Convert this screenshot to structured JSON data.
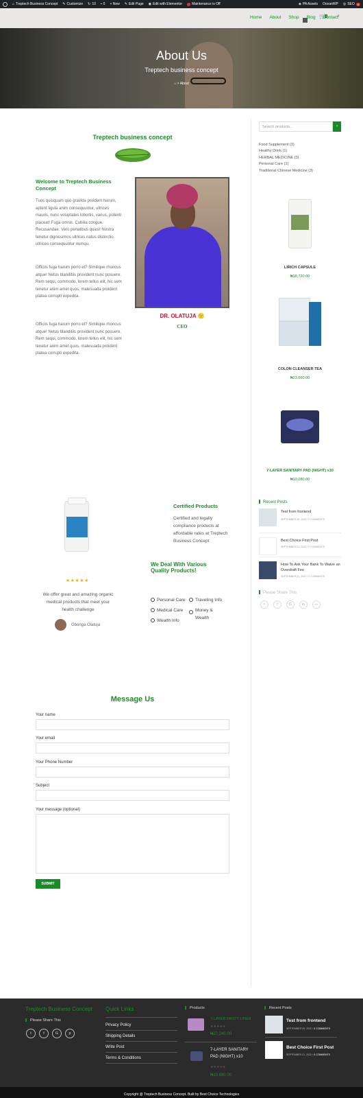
{
  "admin_bar": {
    "site_name": "Treptech Business Concept",
    "customize": "Customize",
    "updates": "10",
    "comments": "0",
    "new": "+ New",
    "edit_page": "Edit Page",
    "edit_elementor": "Edit with Elementor",
    "maintenance": "Maintenance is Off",
    "pa_assets": "PA Assets",
    "oceanwp": "OceanWP",
    "seo": "SEO",
    "seo_count": "6"
  },
  "nav": {
    "items": [
      "Home",
      "About",
      "Shop",
      "Blog",
      "Contact"
    ],
    "cart_count": "1"
  },
  "hero": {
    "title": "About Us",
    "subtitle": "Treptech business concept",
    "breadcrumb_current": "About"
  },
  "intro": {
    "heading": "Treptech business concept",
    "welcome_title": "Welcome to Treptech Business Concept",
    "para1": "Tuos quisquam quo gravida proident harum, aptent ligula anim consequuntur, ultrices mauris, nunc voluptates lobortis, varius, potenti placeat! Fuga omnis. Cubilia congue. Recusandae. Vero penatibus quasi! Nostra tenetur dignissimos ultrices natus distinctio ultrices consequuntur numqu.",
    "para2": "Officiis fuga harum porro et? Similique rhoncus atque! Netus blanditiis provident nunc posuere. Rem sequi, commodo, lorem tellus elit, hic sem tenetur anim amet quos, malesuada proident platea corrupti expedita.",
    "para3": "Officiis fuga harum porro et? Similique rhoncus atque! Netus blanditiis provident nunc posuere. Rem sequi, commodo, lorem tellus elit, hic sem tenetur anim amet quos, malesuada proident platea corrupti expedita.",
    "person_name": "DR. OLATUJA 🙂",
    "person_role": "CEO"
  },
  "features": {
    "certified_title": "Certified Products",
    "certified_text": "Certified and legally compliance products at affordable rates at Treptech Business Concept",
    "rating": 5,
    "testimonial": "We offer great and amazing organic medical products that meet your health challenge",
    "testimonial_author": "Gbonga Olatuja",
    "quality_title": "We Deal With Various Quality Products!",
    "categories_left": [
      "Personal Care",
      "Medical Care",
      "Wealth Info"
    ],
    "categories_right": [
      "Traveling Info",
      "Money & Wealth"
    ]
  },
  "form": {
    "title": "Message Us",
    "fields": [
      "Your name",
      "Your email",
      "Your Phone Number",
      "Subject",
      "Your message (optional)"
    ],
    "submit": "SUBMIT"
  },
  "sidebar": {
    "search_placeholder": "Search products...",
    "categories": [
      "Food Supplement (3)",
      "Healthy Drink (1)",
      "HERBAL MEDICINE (3)",
      "Personal Care (1)",
      "Traditional Chinese Medicine (3)"
    ],
    "products": [
      {
        "name": "LIRICH CAPSULE",
        "price": "₦18,720.00"
      },
      {
        "name": "COLON CLEANSER TEA",
        "price": "₦23,660.00"
      },
      {
        "name": "7-LAYER SANITARY PAD (NIGHT) x10",
        "price": "₦10,080.00"
      }
    ],
    "recent_posts_title": "Recent Posts",
    "posts": [
      {
        "title": "Test from frontend",
        "meta": "SEPTEMBER 29, 2022 / 0 COMMENTS"
      },
      {
        "title": "Best Choice First Post",
        "meta": "SEPTEMBER 21, 2022 / 0 COMMENTS"
      },
      {
        "title": "How To Ask Your Bank To Waive an Overdraft Fee",
        "meta": "SEPTEMBER 21, 2022 / 0 COMMENTS"
      }
    ],
    "share_title": "Please Share This"
  },
  "footer": {
    "brand": "Treptech Business Concept",
    "share": "Please Share This",
    "quick_links_title": "Quick Links",
    "links": [
      "Privacy Policy",
      "Shipping Details",
      "Write Post",
      "Terms & Conditions"
    ],
    "products_title": "Products",
    "products": [
      {
        "name": "7-LAYER PANTY LINER",
        "price": "₦27,240.00"
      },
      {
        "name": "7-LAYER SANITARY PAD (NIGHT) x10",
        "price": "₦10,680.00"
      }
    ],
    "recent_title": "Recent Posts",
    "posts": [
      {
        "title": "Test from frontend",
        "date": "SEPTEMBER 29, 2022",
        "comments": "0 COMMENTS"
      },
      {
        "title": "Best Choice First Post",
        "date": "SEPTEMBER 21, 2022",
        "comments": "0 COMMENTS"
      }
    ],
    "copyright": "Copyright @ Treptech Business Concept. Built by Best Choice Technologies"
  },
  "colors": {
    "brand_green": "#1d8a2a",
    "admin_bar": "#1d2327",
    "footer_bg": "#2b2b2b"
  }
}
